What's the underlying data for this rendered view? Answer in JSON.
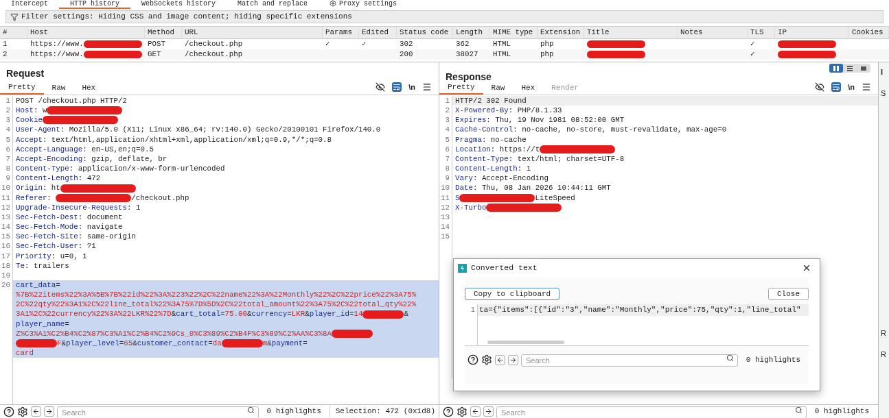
{
  "proxy_tabs": [
    {
      "label": "Intercept",
      "selected": false
    },
    {
      "label": "HTTP history",
      "selected": true
    },
    {
      "label": "WebSockets history",
      "selected": false
    },
    {
      "label": "Match and replace",
      "selected": false
    },
    {
      "label": "Proxy settings",
      "selected": false,
      "kind": "settings"
    }
  ],
  "filter": "Filter settings: Hiding CSS and image content; hiding specific extensions",
  "table": {
    "columns": [
      "#",
      "Host",
      "Method",
      "URL",
      "Params",
      "Edited",
      "Status code",
      "Length",
      "MIME type",
      "Extension",
      "Title",
      "Notes",
      "TLS",
      "IP",
      "Cookies"
    ],
    "rows": [
      {
        "selected": false,
        "cells": [
          {
            "text": "1"
          },
          {
            "text": "https://www.",
            "redacted": true
          },
          {
            "text": "POST"
          },
          {
            "text": "/checkout.php"
          },
          {
            "text": "✓"
          },
          {
            "text": "✓"
          },
          {
            "text": "302"
          },
          {
            "text": "362"
          },
          {
            "text": "HTML"
          },
          {
            "text": "php"
          },
          {
            "redacted": true
          },
          {},
          {
            "text": "✓"
          },
          {
            "redacted": true
          },
          {}
        ]
      },
      {
        "selected": false,
        "cells": [
          {
            "text": "2"
          },
          {
            "text": "https://www.",
            "redacted": true
          },
          {
            "text": "GET"
          },
          {
            "text": "/checkout.php"
          },
          {},
          {},
          {
            "text": "200"
          },
          {
            "text": "38027"
          },
          {
            "text": "HTML"
          },
          {
            "text": "php"
          },
          {
            "redacted": true
          },
          {},
          {
            "text": "✓"
          },
          {
            "redacted": true
          },
          {}
        ]
      }
    ]
  },
  "request": {
    "title": "Request",
    "newline_label": "\\n",
    "tabs": [
      {
        "label": "Pretty",
        "selected": true,
        "disabled": false
      },
      {
        "label": "Raw",
        "selected": false,
        "disabled": false
      },
      {
        "label": "Hex",
        "selected": false,
        "disabled": false
      }
    ],
    "lines": [
      {
        "num": "1",
        "selected": false,
        "parts": [
          {
            "kind": "text",
            "text": "POST /checkout.php HTTP/2"
          }
        ]
      },
      {
        "num": "2",
        "selected": false,
        "parts": [
          {
            "kind": "key",
            "text": "Host"
          },
          {
            "kind": "text",
            "text": ": w"
          },
          {
            "kind": "redaction"
          }
        ]
      },
      {
        "num": "3",
        "selected": false,
        "parts": [
          {
            "kind": "key",
            "text": "Cookie"
          },
          {
            "kind": "redaction"
          }
        ]
      },
      {
        "num": "4",
        "selected": false,
        "parts": [
          {
            "kind": "key",
            "text": "User-Agent"
          },
          {
            "kind": "text",
            "text": ": Mozilla/5.0 (X11; Linux x86_64; rv:140.0) Gecko/20100101 Firefox/140.0"
          }
        ]
      },
      {
        "num": "5",
        "selected": false,
        "parts": [
          {
            "kind": "key",
            "text": "Accept"
          },
          {
            "kind": "text",
            "text": ": text/html,application/xhtml+xml,application/xml;q=0.9,*/*;q=0.8"
          }
        ]
      },
      {
        "num": "6",
        "selected": false,
        "parts": [
          {
            "kind": "key",
            "text": "Accept-Language"
          },
          {
            "kind": "text",
            "text": ": en-US,en;q=0.5"
          }
        ]
      },
      {
        "num": "7",
        "selected": false,
        "parts": [
          {
            "kind": "key",
            "text": "Accept-Encoding"
          },
          {
            "kind": "text",
            "text": ": gzip, deflate, br"
          }
        ]
      },
      {
        "num": "8",
        "selected": false,
        "parts": [
          {
            "kind": "key",
            "text": "Content-Type"
          },
          {
            "kind": "text",
            "text": ": application/x-www-form-urlencoded"
          }
        ]
      },
      {
        "num": "9",
        "selected": false,
        "parts": [
          {
            "kind": "key",
            "text": "Content-Length"
          },
          {
            "kind": "text",
            "text": ": 472"
          }
        ]
      },
      {
        "num": "10",
        "selected": false,
        "parts": [
          {
            "kind": "key",
            "text": "Origin"
          },
          {
            "kind": "text",
            "text": ": ht"
          },
          {
            "kind": "redaction"
          }
        ]
      },
      {
        "num": "11",
        "selected": false,
        "parts": [
          {
            "kind": "key",
            "text": "Referer"
          },
          {
            "kind": "text",
            "text": ": "
          },
          {
            "kind": "redaction"
          },
          {
            "kind": "text",
            "text": "/checkout.php"
          }
        ]
      },
      {
        "num": "12",
        "selected": false,
        "parts": [
          {
            "kind": "key",
            "text": "Upgrade-Insecure-Requests"
          },
          {
            "kind": "text",
            "text": ": 1"
          }
        ]
      },
      {
        "num": "13",
        "selected": false,
        "parts": [
          {
            "kind": "key",
            "text": "Sec-Fetch-Dest"
          },
          {
            "kind": "text",
            "text": ": document"
          }
        ]
      },
      {
        "num": "14",
        "selected": false,
        "parts": [
          {
            "kind": "key",
            "text": "Sec-Fetch-Mode"
          },
          {
            "kind": "text",
            "text": ": navigate"
          }
        ]
      },
      {
        "num": "15",
        "selected": false,
        "parts": [
          {
            "kind": "key",
            "text": "Sec-Fetch-Site"
          },
          {
            "kind": "text",
            "text": ": same-origin"
          }
        ]
      },
      {
        "num": "16",
        "selected": false,
        "parts": [
          {
            "kind": "key",
            "text": "Sec-Fetch-User"
          },
          {
            "kind": "text",
            "text": ": ?1"
          }
        ]
      },
      {
        "num": "17",
        "selected": false,
        "parts": [
          {
            "kind": "key",
            "text": "Priority"
          },
          {
            "kind": "text",
            "text": ": u=0, i"
          }
        ]
      },
      {
        "num": "18",
        "selected": false,
        "parts": [
          {
            "kind": "key",
            "text": "Te"
          },
          {
            "kind": "text",
            "text": ": trailers"
          }
        ]
      },
      {
        "num": "19",
        "selected": false
      },
      {
        "num": "20",
        "selected": true,
        "rows": [
          {
            "parts": [
              {
                "kind": "key",
                "text": "cart_data"
              },
              {
                "kind": "text",
                "text": "="
              }
            ]
          },
          {
            "parts": [
              {
                "kind": "value",
                "text": "%7B%22items%22%3A%5B%7B%22id%22%3A%223%22%2C%22name%22%3A%22Monthly%22%2C%22price%22%3A75%"
              }
            ]
          },
          {
            "parts": [
              {
                "kind": "value",
                "text": "2C%22qty%22%3A1%2C%22line_total%22%3A75%7D%5D%2C%22total_amount%22%3A75%2C%22total_qty%22%"
              }
            ]
          },
          {
            "parts": [
              {
                "kind": "value",
                "text": "3A1%2C%22currency%22%3A%22LKR%22%7D"
              },
              {
                "kind": "text",
                "text": "&"
              },
              {
                "kind": "key",
                "text": "cart_total"
              },
              {
                "kind": "text",
                "text": "="
              },
              {
                "kind": "value",
                "text": "75.00"
              },
              {
                "kind": "text",
                "text": "&"
              },
              {
                "kind": "key",
                "text": "currency"
              },
              {
                "kind": "text",
                "text": "="
              },
              {
                "kind": "value",
                "text": "LKR"
              },
              {
                "kind": "text",
                "text": "&"
              },
              {
                "kind": "key",
                "text": "player_id"
              },
              {
                "kind": "text",
                "text": "="
              },
              {
                "kind": "value",
                "text": "14"
              },
              {
                "kind": "redaction"
              },
              {
                "kind": "text",
                "text": "&"
              }
            ]
          },
          {
            "parts": [
              {
                "kind": "key",
                "text": "player_name"
              },
              {
                "kind": "text",
                "text": "="
              }
            ]
          },
          {
            "parts": [
              {
                "kind": "value",
                "text": "Z%C3%A1%C2%B4%C2%87%C3%A1%C2%B4%C2%9Cs_0%C3%89%C2%B4F%C3%89%C2%AA%C3%8A"
              },
              {
                "kind": "redaction"
              }
            ]
          },
          {
            "parts": [
              {
                "kind": "redaction"
              },
              {
                "kind": "value",
                "text": "F"
              },
              {
                "kind": "text",
                "text": "&"
              },
              {
                "kind": "key",
                "text": "player_level"
              },
              {
                "kind": "text",
                "text": "="
              },
              {
                "kind": "value",
                "text": "65"
              },
              {
                "kind": "text",
                "text": "&"
              },
              {
                "kind": "key",
                "text": "customer_contact"
              },
              {
                "kind": "text",
                "text": "="
              },
              {
                "kind": "value",
                "text": "da"
              },
              {
                "kind": "redaction"
              },
              {
                "kind": "value",
                "text": "m"
              },
              {
                "kind": "text",
                "text": "&"
              },
              {
                "kind": "key",
                "text": "payment"
              },
              {
                "kind": "text",
                "text": "="
              }
            ]
          },
          {
            "parts": [
              {
                "kind": "value",
                "text": "card"
              }
            ]
          }
        ]
      }
    ],
    "search_placeholder": "Search",
    "highlights": "0 highlights",
    "selection": "Selection: 472 (0x1d8)"
  },
  "response": {
    "title": "Response",
    "newline_label": "\\n",
    "tabs": [
      {
        "label": "Pretty",
        "selected": true,
        "disabled": false
      },
      {
        "label": "Raw",
        "selected": false,
        "disabled": false
      },
      {
        "label": "Hex",
        "selected": false,
        "disabled": false
      },
      {
        "label": "Render",
        "selected": false,
        "disabled": true
      }
    ],
    "lines": [
      {
        "num": "1",
        "selected": true,
        "parts": [
          {
            "kind": "text",
            "text": "HTTP/2 302 Found"
          }
        ]
      },
      {
        "num": "2",
        "selected": false,
        "parts": [
          {
            "kind": "key",
            "text": "X-Powered-By"
          },
          {
            "kind": "text",
            "text": ": PHP/8.1.33"
          }
        ]
      },
      {
        "num": "3",
        "selected": false,
        "parts": [
          {
            "kind": "key",
            "text": "Expires"
          },
          {
            "kind": "text",
            "text": ": Thu, 19 Nov 1981 08:52:00 GMT"
          }
        ]
      },
      {
        "num": "4",
        "selected": false,
        "parts": [
          {
            "kind": "key",
            "text": "Cache-Control"
          },
          {
            "kind": "text",
            "text": ": no-cache, no-store, must-revalidate, max-age=0"
          }
        ]
      },
      {
        "num": "5",
        "selected": false,
        "parts": [
          {
            "kind": "key",
            "text": "Pragma"
          },
          {
            "kind": "text",
            "text": ": no-cache"
          }
        ]
      },
      {
        "num": "6",
        "selected": false,
        "parts": [
          {
            "kind": "key",
            "text": "Location"
          },
          {
            "kind": "text",
            "text": ": https://t"
          },
          {
            "kind": "redaction"
          }
        ]
      },
      {
        "num": "7",
        "selected": false,
        "parts": [
          {
            "kind": "key",
            "text": "Content-Type"
          },
          {
            "kind": "text",
            "text": ": text/html; charset=UTF-8"
          }
        ]
      },
      {
        "num": "8",
        "selected": false,
        "parts": [
          {
            "kind": "key",
            "text": "Content-Length"
          },
          {
            "kind": "text",
            "text": ": 1"
          }
        ]
      },
      {
        "num": "9",
        "selected": false,
        "parts": [
          {
            "kind": "key",
            "text": "Vary"
          },
          {
            "kind": "text",
            "text": ": Accept-Encoding"
          }
        ]
      },
      {
        "num": "10",
        "selected": false,
        "parts": [
          {
            "kind": "key",
            "text": "Date"
          },
          {
            "kind": "text",
            "text": ": Thu, 08 Jan 2026 10:44:11 GMT"
          }
        ]
      },
      {
        "num": "11",
        "selected": false,
        "parts": [
          {
            "kind": "key",
            "text": "S"
          },
          {
            "kind": "redaction"
          },
          {
            "kind": "text",
            "text": "LiteSpeed"
          }
        ]
      },
      {
        "num": "12",
        "selected": false,
        "parts": [
          {
            "kind": "key",
            "text": "X-Turbo"
          },
          {
            "kind": "redaction"
          }
        ]
      },
      {
        "num": "13",
        "selected": false
      },
      {
        "num": "14",
        "selected": false
      },
      {
        "num": "15",
        "selected": false
      }
    ],
    "search_placeholder": "Search",
    "highlights": "0 highlights"
  },
  "layout_modes": [
    {
      "kind": "columns",
      "selected": true
    },
    {
      "kind": "rows",
      "selected": false
    },
    {
      "kind": "single",
      "selected": false
    }
  ],
  "inspector_edge": {
    "title": "I",
    "items": [
      "S",
      "R",
      "R"
    ]
  },
  "dialog": {
    "title": "Converted text",
    "copy_button": "Copy to clipboard",
    "close_button": "Close",
    "line_num": "1",
    "content": "ta={\"items\":[{\"id\":\"3\",\"name\":\"Monthly\",\"price\":75,\"qty\":1,\"line_total\"",
    "search_placeholder": "Search",
    "highlights": "0 highlights"
  }
}
